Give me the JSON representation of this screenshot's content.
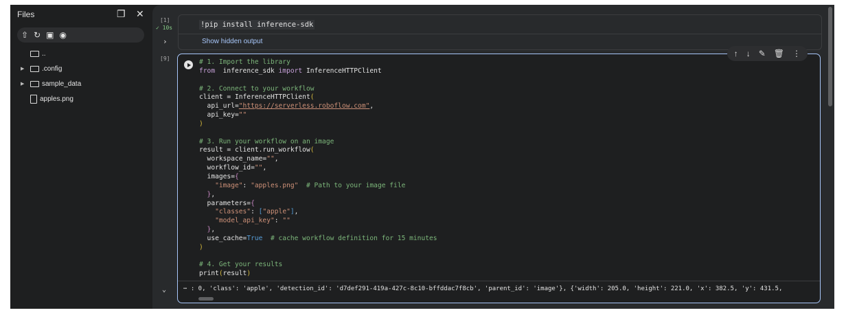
{
  "sidebar": {
    "title": "Files",
    "tree": [
      {
        "name": "..",
        "type": "folder",
        "expandable": false
      },
      {
        "name": ".config",
        "type": "folder",
        "expandable": true
      },
      {
        "name": "sample_data",
        "type": "folder",
        "expandable": true
      },
      {
        "name": "apples.png",
        "type": "file",
        "expandable": false
      }
    ]
  },
  "cell1": {
    "exec_count": "[1]",
    "duration": "10s",
    "code": "!pip install inference-sdk",
    "hidden_output": "Show hidden output"
  },
  "cell2": {
    "exec_count": "[9]",
    "code": [
      [
        [
          "c",
          "# 1. Import the library"
        ]
      ],
      [
        [
          "k",
          "from"
        ],
        [
          "",
          "  inference_sdk "
        ],
        [
          "k",
          "import"
        ],
        [
          "",
          " InferenceHTTPClient"
        ]
      ],
      [],
      [
        [
          "c",
          "# 2. Connect to your workflow"
        ]
      ],
      [
        [
          "",
          "client = InferenceHTTPClient"
        ],
        [
          "y",
          "("
        ]
      ],
      [
        [
          "",
          "  api_url="
        ],
        [
          "u",
          "\"https://serverless.roboflow.com\""
        ],
        [
          "",
          ","
        ]
      ],
      [
        [
          "",
          "  api_key="
        ],
        [
          "s",
          "\"\""
        ]
      ],
      [
        [
          "y",
          ")"
        ]
      ],
      [],
      [
        [
          "c",
          "# 3. Run your workflow on an image"
        ]
      ],
      [
        [
          "",
          "result = client.run_workflow"
        ],
        [
          "y",
          "("
        ]
      ],
      [
        [
          "",
          "  workspace_name="
        ],
        [
          "s",
          "\"\""
        ],
        [
          "",
          ","
        ]
      ],
      [
        [
          "",
          "  workflow_id="
        ],
        [
          "s",
          "\"\""
        ],
        [
          "",
          ","
        ]
      ],
      [
        [
          "",
          "  images="
        ],
        [
          "p",
          "{"
        ]
      ],
      [
        [
          "s",
          "    \"image\""
        ],
        [
          "",
          ": "
        ],
        [
          "s",
          "\"apples.png\""
        ],
        [
          "c",
          "  # Path to your image file"
        ]
      ],
      [
        [
          "p",
          "  }"
        ],
        [
          "",
          ","
        ]
      ],
      [
        [
          "",
          "  parameters="
        ],
        [
          "p",
          "{"
        ]
      ],
      [
        [
          "s",
          "    \"classes\""
        ],
        [
          "",
          ": "
        ],
        [
          "b",
          "["
        ],
        [
          "s",
          "\"apple\""
        ],
        [
          "b",
          "]"
        ],
        [
          "",
          ","
        ]
      ],
      [
        [
          "s",
          "    \"model_api_key\""
        ],
        [
          "",
          ": "
        ],
        [
          "s",
          "\"\""
        ]
      ],
      [
        [
          "p",
          "  }"
        ],
        [
          "",
          ","
        ]
      ],
      [
        [
          "",
          "  use_cache="
        ],
        [
          "b",
          "True"
        ],
        [
          "c",
          "  # cache workflow definition for 15 minutes"
        ]
      ],
      [
        [
          "y",
          ")"
        ]
      ],
      [],
      [
        [
          "c",
          "# 4. Get your results"
        ]
      ],
      [
        [
          "",
          "print"
        ],
        [
          "y",
          "("
        ],
        [
          "",
          "result"
        ],
        [
          "y",
          ")"
        ]
      ]
    ],
    "output": ": 0, 'class': 'apple', 'detection_id': 'd7def291-419a-427c-8c10-bffddac7f8cb', 'parent_id': 'image'}, {'width': 205.0, 'height': 221.0, 'x': 382.5, 'y': 431.5,"
  }
}
